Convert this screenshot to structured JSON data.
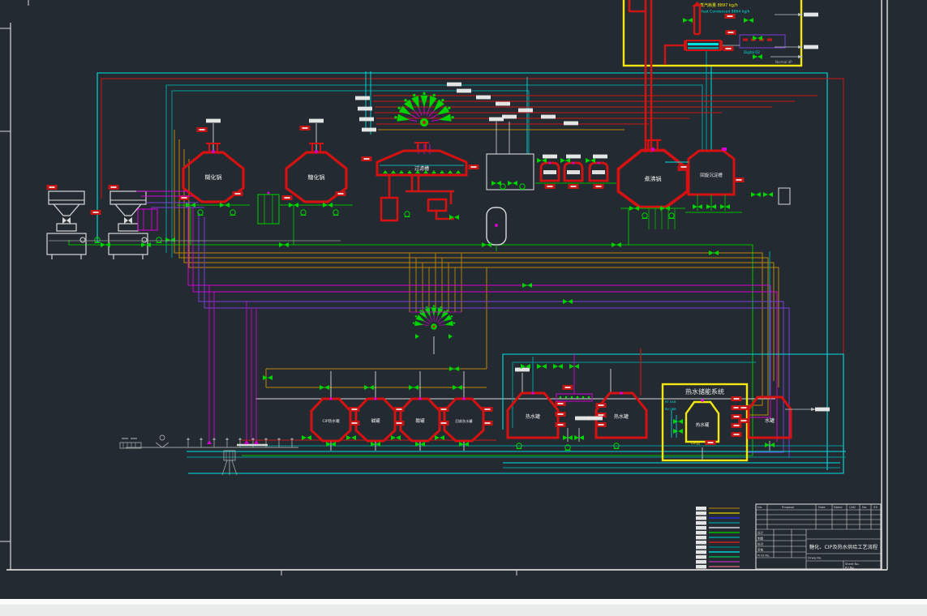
{
  "window": {
    "background": "#242a31",
    "frame_color": "#e8e8e8",
    "bottom_bar_top": "#fbfcfc",
    "bottom_bar_bottom": "#e8eceb"
  },
  "colors": {
    "pipe_red": "#cc1616",
    "equipment_red": "#d51111",
    "valve_green": "#00d200",
    "pipe_green": "#00bb00",
    "cyan": "#00e0e0",
    "teal": "#00999b",
    "magenta": "#d400d4",
    "purple": "#7a3cd6",
    "ochre": "#b8860b",
    "highlight_yellow": "#f2e613",
    "white": "#e8e8e8"
  },
  "vessels": {
    "gelatinization": "糊化锅",
    "saccharification": "糖化锅",
    "lauter": "过滤槽",
    "boiling": "煮沸锅",
    "whirlpool": "回旋沉淀槽",
    "cip_hot_tank": "CIP热水罐",
    "caustic_tank": "碱罐",
    "acid_tank": "酸罐",
    "recovered_water_tank": "回收洗水罐",
    "hot_water_tank_1": "热水罐",
    "hot_water_tank_2": "热水罐",
    "storage_hot_tank": "热水罐",
    "water_tank": "水罐"
  },
  "systems": {
    "hot_water_storage_title": "热水储能系统"
  },
  "annotations": {
    "steam_note_1": "蒸汽耗量 8897 kg/h",
    "steam_note_2": "Heat Condensed 8864 kg/h",
    "digital_label": "Digital O2",
    "dp_label": "Normal dP",
    "cip_return_label": "CIP回",
    "storage_tag_1": "RT 04B",
    "storage_tag_2": "RV 08B"
  },
  "legend": {
    "items": [
      "#8b6914",
      "#c8b400",
      "#2a2ae0",
      "#008c8c",
      "#d8d8d8",
      "#00bb00",
      "#00a0a0",
      "#cc2020",
      "#007878",
      "#00d8d8",
      "#00b050",
      "#a030a0",
      "#c06078"
    ]
  },
  "title_block": {
    "headers": [
      "No.",
      "Proposal",
      "Date",
      "Name",
      "CAD",
      "No.",
      "XX"
    ],
    "title": "糖化、CIP及热水供给工艺流程",
    "rows": [
      "设计",
      "制图",
      "校对",
      "审核",
      "Print No."
    ],
    "drwg_label": "Drwg No.",
    "sheet_label": "Sheet No.",
    "prj_label": "Prj No."
  }
}
